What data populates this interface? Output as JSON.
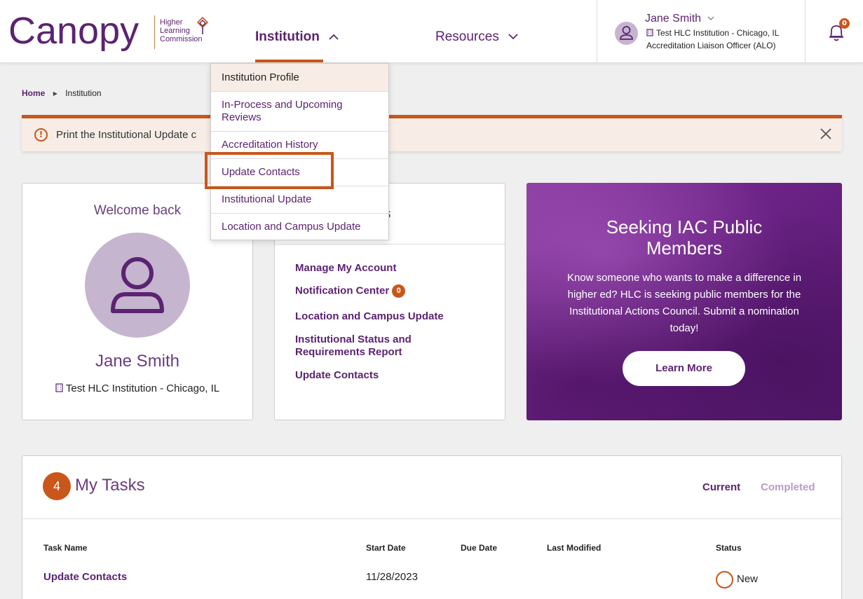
{
  "header": {
    "logo_text": "Canopy",
    "logo_sub": [
      "Higher",
      "Learning",
      "Commission"
    ],
    "nav": {
      "institution": "Institution",
      "resources": "Resources"
    },
    "user": {
      "name": "Jane Smith",
      "institution": "Test HLC Institution - Chicago, IL",
      "role": "Accreditation Liaison Officer (ALO)"
    },
    "notification_count": "0"
  },
  "breadcrumb": {
    "home": "Home",
    "current": "Institution"
  },
  "alert": {
    "text": "Print the Institutional Update c"
  },
  "dropdown": {
    "items": [
      "Institution Profile",
      "In-Process and Upcoming Reviews",
      "Accreditation History",
      "Update Contacts",
      "Institutional Update",
      "Location and Campus Update"
    ]
  },
  "welcome": {
    "title": "Welcome back",
    "name": "Jane Smith",
    "institution": "Test HLC Institution - Chicago, IL"
  },
  "quick_links": {
    "heading_fragment": "s",
    "items": [
      "Manage My Account",
      "Notification Center",
      "Location and Campus Update",
      "Institutional Status and Requirements Report",
      "Update Contacts"
    ],
    "notification_badge": "0"
  },
  "promo": {
    "title": "Seeking IAC Public Members",
    "body": "Know someone who wants to make a difference in higher ed? HLC is seeking public members for the Institutional Actions Council. Submit a nomination today!",
    "button": "Learn More"
  },
  "tasks": {
    "count": "4",
    "title": "My Tasks",
    "tabs": {
      "current": "Current",
      "completed": "Completed"
    },
    "columns": [
      "Task Name",
      "Start Date",
      "Due Date",
      "Last Modified",
      "Status"
    ],
    "rows": [
      {
        "name": "Update Contacts",
        "start": "11/28/2023",
        "due": "",
        "modified": "",
        "status": "New"
      }
    ]
  }
}
